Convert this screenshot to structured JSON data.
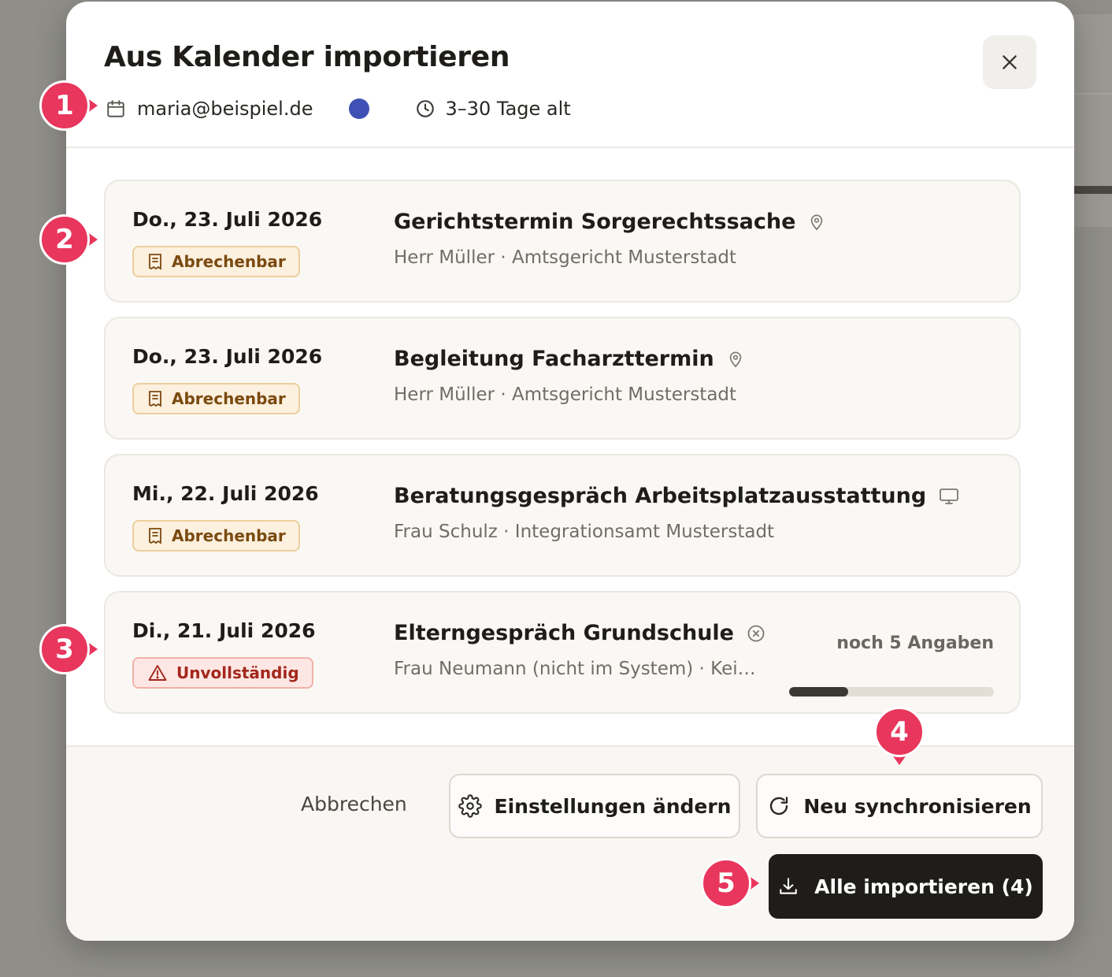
{
  "modal": {
    "title": "Aus Kalender importieren",
    "account_email": "maria@beispiel.de",
    "calendar_color": "#3f51b5",
    "age_range": "3–30 Tage alt"
  },
  "events": [
    {
      "date": "Do., 23. Juli 2026",
      "badge": "Abrechenbar",
      "badge_type": "billable",
      "title": "Gerichtstermin Sorgerechtssache",
      "type_icon": "location-pin-icon",
      "subtitle": "Herr Müller · Amtsgericht Musterstadt"
    },
    {
      "date": "Do., 23. Juli 2026",
      "badge": "Abrechenbar",
      "badge_type": "billable",
      "title": "Begleitung Facharzttermin",
      "type_icon": "location-pin-icon",
      "subtitle": "Herr Müller · Amtsgericht Musterstadt"
    },
    {
      "date": "Mi., 22. Juli 2026",
      "badge": "Abrechenbar",
      "badge_type": "billable",
      "title": "Beratungsgespräch Arbeitsplatzausstattung",
      "type_icon": "monitor-icon",
      "subtitle": "Frau Schulz · Integrationsamt Musterstadt"
    },
    {
      "date": "Di., 21. Juli 2026",
      "badge": "Unvollständig",
      "badge_type": "incomplete",
      "title": "Elterngespräch Grundschule",
      "type_icon": "circle-x-icon",
      "subtitle": "Frau Neumann (nicht im System) · Kein ...",
      "remaining": "noch 5 Angaben",
      "progress_fraction": 0.29
    }
  ],
  "footer": {
    "cancel_label": "Abbrechen",
    "settings_label": "Einstellungen ändern",
    "sync_label": "Neu synchronisieren",
    "import_label": "Alle importieren (4)"
  },
  "markers": [
    "1",
    "2",
    "3",
    "4",
    "5"
  ],
  "colors": {
    "marker": "#e8365d",
    "primary_button": "#1f1d1a",
    "billable_badge": "#fcf0de",
    "incomplete_badge": "#fde7e4"
  }
}
